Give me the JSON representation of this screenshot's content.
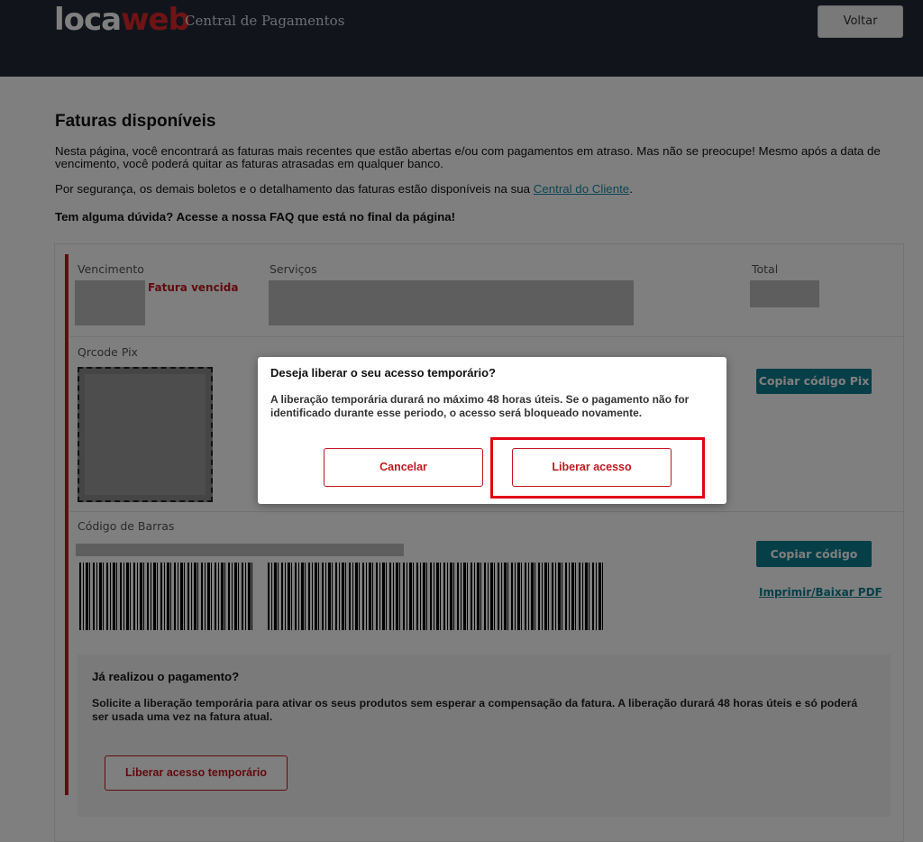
{
  "header": {
    "logo_part1": "loca",
    "logo_part2": "web",
    "subtitle": "Central de Pagamentos",
    "back_button": "Voltar"
  },
  "main": {
    "title": "Faturas disponíveis",
    "intro": "Nesta página, você encontrará as faturas mais recentes que estão abertas e/ou com pagamentos em atraso. Mas não se preocupe! Mesmo após a data de vencimento, você poderá quitar as faturas atrasadas em qualquer banco.",
    "security_text": "Por segurança, os demais boletos e o detalhamento das faturas estão disponíveis na sua",
    "client_link": "Central do Cliente",
    "faq_text": "Tem alguma dúvida? Acesse a nossa FAQ que está no final da página!"
  },
  "invoice": {
    "col_due": "Vencimento",
    "col_services": "Serviços",
    "col_total": "Total",
    "status": "Fatura vencida",
    "pix_label": "Qrcode Pix",
    "copy_pix_button": "Copiar código Pix",
    "barcode_label": "Código de Barras",
    "copy_code_button": "Copiar código",
    "print_link": "Imprimir/Baixar PDF"
  },
  "payment": {
    "title": "Já realizou o pagamento?",
    "text": "Solicite a liberação temporária para ativar os seus produtos sem esperar a compensação da fatura. A liberação durará 48 horas úteis e só poderá ser usada uma vez na fatura atual.",
    "button": "Liberar acesso temporário"
  },
  "modal": {
    "title": "Deseja liberar o seu acesso temporário?",
    "text": "A liberação temporária durará no máximo 48 horas úteis. Se o pagamento não for identificado durante esse periodo, o acesso será bloqueado novamente.",
    "cancel_button": "Cancelar",
    "confirm_button": "Liberar acesso"
  },
  "colors": {
    "header_bg": "#232b36",
    "accent_red": "#c0191f",
    "teal": "#0f7f91",
    "highlight": "#e20613"
  }
}
